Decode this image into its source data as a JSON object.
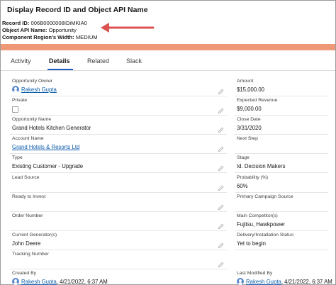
{
  "header": {
    "title": "Display Record ID and Object API Name",
    "record_id_label": "Record ID:",
    "record_id_value": "006B0000008IDiMKIA0",
    "object_api_label": "Object API Name:",
    "object_api_value": "Opportunity",
    "region_width_label": "Component Region's Width:",
    "region_width_value": "MEDIUM"
  },
  "colors": {
    "arrow": "#d9534f",
    "band": "#ef9878",
    "link": "#0b5cab",
    "tab_underline": "#1b5fc1"
  },
  "tabs": [
    {
      "label": "Activity",
      "active": false
    },
    {
      "label": "Details",
      "active": true
    },
    {
      "label": "Related",
      "active": false
    },
    {
      "label": "Slack",
      "active": false
    }
  ],
  "left_fields": [
    {
      "label": "Opportunity Owner",
      "value": "Rakesh Gupta",
      "link": true,
      "avatar": true
    },
    {
      "label": "Private",
      "value": "",
      "checkbox": true
    },
    {
      "label": "Opportunity Name",
      "value": "Grand Hotels Kitchen Generator"
    },
    {
      "label": "Account Name",
      "value": "Grand Hotels & Resorts Ltd",
      "link": true
    },
    {
      "label": "Type",
      "value": "Existing Customer - Upgrade"
    },
    {
      "label": "Lead Source",
      "value": ""
    },
    {
      "label": "Ready to Invest",
      "value": ""
    },
    {
      "label": "Order Number",
      "value": ""
    },
    {
      "label": "Current Generator(s)",
      "value": "John Deere"
    },
    {
      "label": "Tracking Number",
      "value": ""
    },
    {
      "label": "Created By",
      "value": "Rakesh Gupta",
      "link": true,
      "avatar": true,
      "suffix": ", 4/21/2022, 6:37 AM"
    }
  ],
  "right_fields": [
    {
      "label": "Amount",
      "value": "$15,000.00"
    },
    {
      "label": "Expected Revenue",
      "value": "$9,000.00"
    },
    {
      "label": "Close Date",
      "value": "3/31/2020"
    },
    {
      "label": "Next Step",
      "value": ""
    },
    {
      "label": "Stage",
      "value": "Id. Decision Makers"
    },
    {
      "label": "Probability (%)",
      "value": "60%"
    },
    {
      "label": "Primary Campaign Source",
      "value": ""
    },
    {
      "label": "Main Competitor(s)",
      "value": "Fujitsu, Hawkpower"
    },
    {
      "label": "Delivery/Installation Status",
      "value": "Yet to begin"
    },
    {
      "label": "Last Modified By",
      "value": "Rakesh Gupta",
      "link": true,
      "avatar": true,
      "suffix": ", 4/21/2022, 6:37 AM"
    }
  ]
}
